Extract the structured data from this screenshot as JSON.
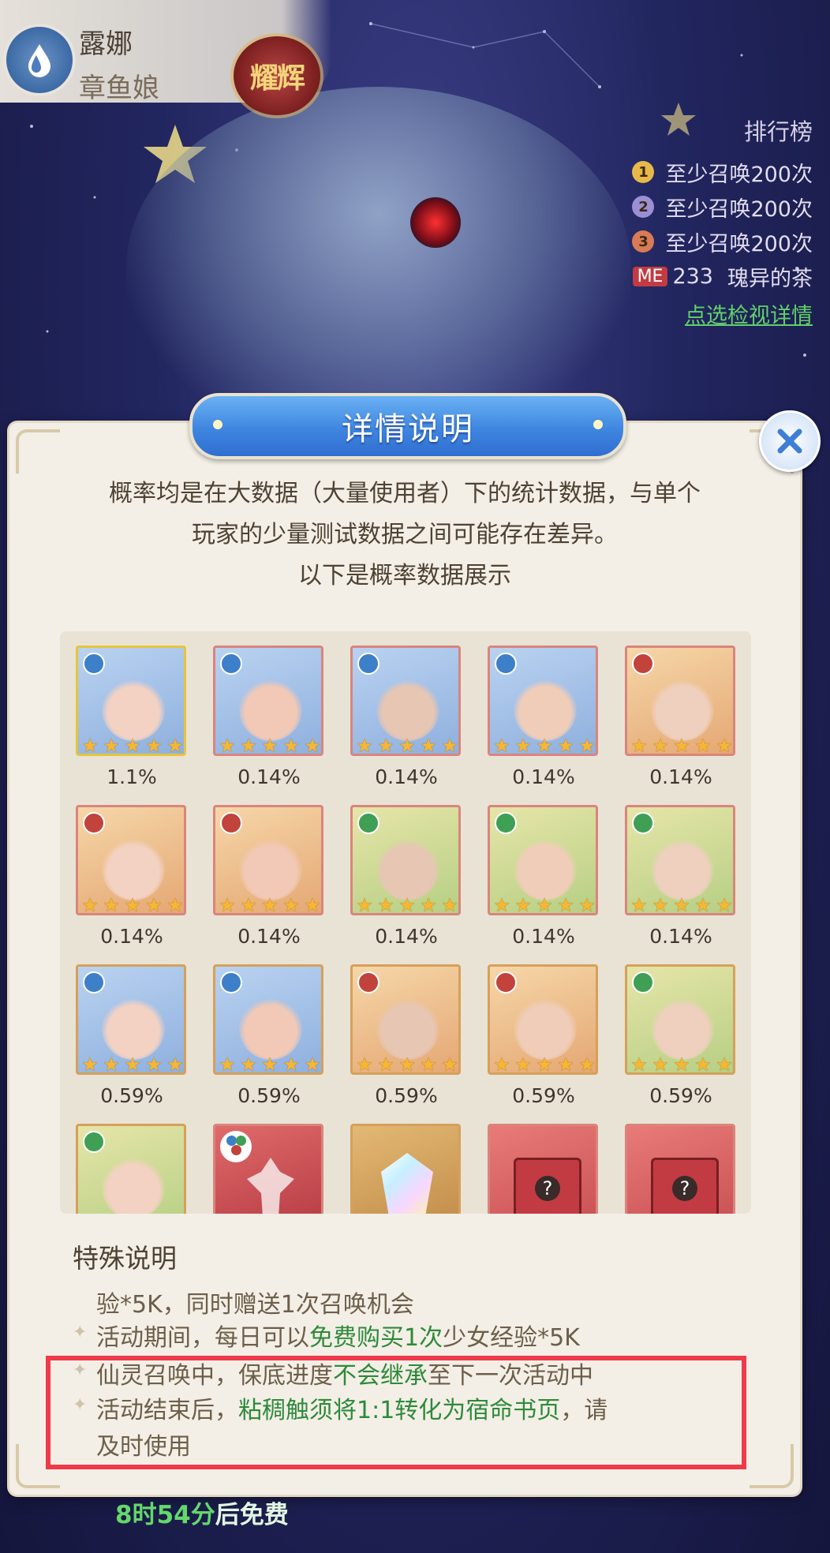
{
  "character": {
    "name": "露娜",
    "title": "章鱼娘",
    "rarity_badge": "耀辉",
    "element_icon": "water-drop-icon"
  },
  "ranking": {
    "title": "排行榜",
    "rows": [
      {
        "rank": "1",
        "text": "至少召唤200次",
        "color": "#e7b94a"
      },
      {
        "rank": "2",
        "text": "至少召唤200次",
        "color": "#9b8fd6"
      },
      {
        "rank": "3",
        "text": "至少召唤200次",
        "color": "#d97b57"
      }
    ],
    "me_tag": "ME",
    "me_rank": "233",
    "me_name": "瑰异的茶",
    "link": "点选检视详情"
  },
  "dialog": {
    "title": "详情说明",
    "close_icon": "close-x-icon",
    "intro_lines": [
      "概率均是在大数据（大量使用者）下的统计数据，与单个",
      "玩家的少量测试数据之间可能存在差异。",
      "以下是概率数据展示"
    ]
  },
  "grid": {
    "rows": [
      [
        {
          "pct": "1.1%",
          "element": "water",
          "border": "gold",
          "stars": 5
        },
        {
          "pct": "0.14%",
          "element": "water",
          "border": "red",
          "stars": 5
        },
        {
          "pct": "0.14%",
          "element": "water",
          "border": "red",
          "stars": 5
        },
        {
          "pct": "0.14%",
          "element": "water",
          "border": "red",
          "stars": 5
        },
        {
          "pct": "0.14%",
          "element": "fire",
          "border": "red",
          "stars": 5
        }
      ],
      [
        {
          "pct": "0.14%",
          "element": "fire",
          "border": "red",
          "stars": 5
        },
        {
          "pct": "0.14%",
          "element": "fire",
          "border": "red",
          "stars": 5
        },
        {
          "pct": "0.14%",
          "element": "wind",
          "border": "red",
          "stars": 5
        },
        {
          "pct": "0.14%",
          "element": "wind",
          "border": "red",
          "stars": 5
        },
        {
          "pct": "0.14%",
          "element": "wind",
          "border": "red",
          "stars": 5
        }
      ],
      [
        {
          "pct": "0.59%",
          "element": "water",
          "border": "bronze",
          "stars": 5
        },
        {
          "pct": "0.59%",
          "element": "water",
          "border": "bronze",
          "stars": 5
        },
        {
          "pct": "0.59%",
          "element": "fire",
          "border": "bronze",
          "stars": 5
        },
        {
          "pct": "0.59%",
          "element": "fire",
          "border": "bronze",
          "stars": 5
        },
        {
          "pct": "0.59%",
          "element": "wind",
          "border": "bronze",
          "stars": 5
        }
      ],
      [
        {
          "pct": "",
          "element": "wind",
          "border": "bronze",
          "stars": 0
        },
        {
          "pct": "",
          "element": "multi",
          "border": "red",
          "stars": 0
        },
        {
          "pct": "",
          "element": "crystal",
          "border": "bronze",
          "stars": 0
        },
        {
          "pct": "",
          "element": "mystery-box",
          "border": "red",
          "stars": 0
        },
        {
          "pct": "",
          "element": "mystery-box",
          "border": "red",
          "stars": 0
        }
      ]
    ],
    "element_colors": {
      "water": "#3d7fc8",
      "fire": "#c2433c",
      "wind": "#3f9f55",
      "multi": "#ffffff"
    }
  },
  "special": {
    "title": "特殊说明",
    "line0": "验*5K，同时赠送1次召唤机会",
    "line1_a": "活动期间，每日可以",
    "line1_hl": "免费购买1次",
    "line1_b": "少女经验*5K",
    "line2_a": "仙灵召唤中，保底进度",
    "line2_hl": "不会继承",
    "line2_b": "至下一次活动中",
    "line3_a": "活动结束后，",
    "line3_hl": "粘稠触须将1:1转化为宿命书页",
    "line3_b": "，请",
    "line3_c": "及时使用"
  },
  "footer": {
    "timer": "8时54分",
    "timer_suffix": "后免费"
  },
  "colors": {
    "accent_blue": "#3f86e0",
    "highlight_green": "#2e8a3a",
    "annotation_red": "#ee3a4a"
  }
}
